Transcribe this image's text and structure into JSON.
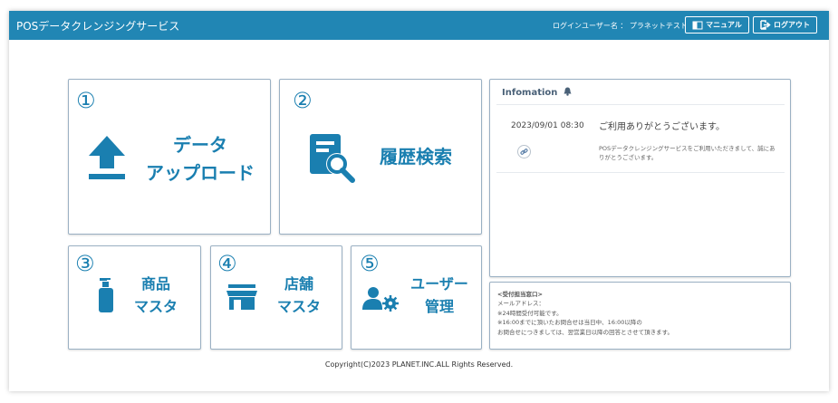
{
  "header": {
    "app_title": "POSデータクレンジングサービス",
    "user_label": "ログインユーザー名 ： プラネットテスト",
    "manual_label": "マニュアル",
    "logout_label": "ログアウト"
  },
  "tiles": {
    "upload": {
      "number": "①",
      "line1": "データ",
      "line2": "アップロード"
    },
    "history": {
      "number": "②",
      "label": "履歴検索"
    },
    "product": {
      "number": "③",
      "line1": "商品",
      "line2": "マスタ"
    },
    "store": {
      "number": "④",
      "line1": "店舗",
      "line2": "マスタ"
    },
    "user": {
      "number": "⑤",
      "line1": "ユーザー",
      "line2": "管理"
    }
  },
  "info": {
    "title": "Infomation",
    "date": "2023/09/01 08:30",
    "news_title": "ご利用ありがとうございます。",
    "news_body": "POSデータクレンジングサービスをご利用いただきまして、誠にありがとうございます。"
  },
  "contact": {
    "title": "<受付担当窓口>",
    "mail": "メールアドレス：",
    "line1": "※24時間受付可能です。",
    "line2": "※16:00までに頂いたお問合せは当日中、16:00以降の",
    "line3": "お問合せにつきましては、翌営業日以降の回答とさせて頂きます。"
  },
  "footer": {
    "copyright": "Copyright(C)2023 PLANET.INC.ALL Rights Reserved."
  },
  "colors": {
    "header": "#2186b4",
    "accent": "#1a7fb0"
  },
  "icons": [
    "upload-icon",
    "search-document-icon",
    "bottle-icon",
    "store-icon",
    "user-gear-icon",
    "bell-icon",
    "link-icon",
    "manual-icon",
    "logout-icon"
  ]
}
